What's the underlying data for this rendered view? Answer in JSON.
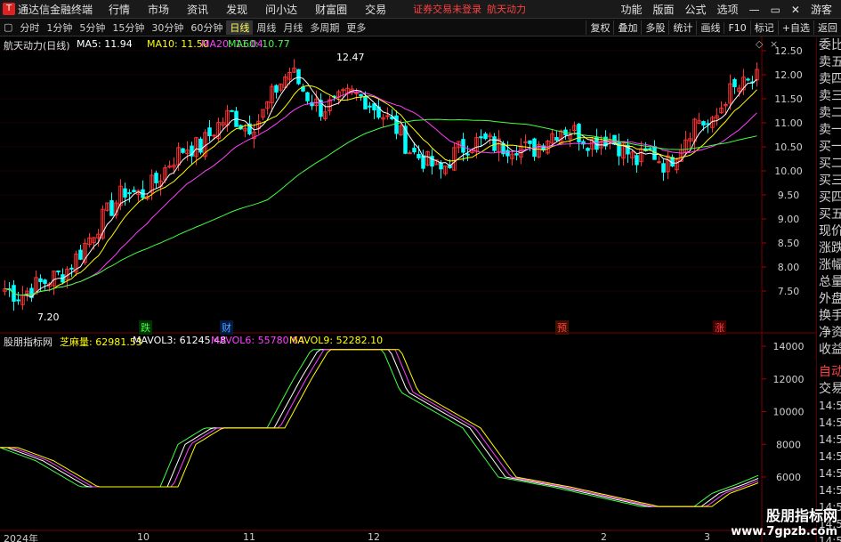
{
  "menubar": {
    "app_title": "通达信金融终端",
    "items": [
      "行情",
      "市场",
      "资讯",
      "发现",
      "问小达",
      "财富圈",
      "交易"
    ],
    "notice": "证券交易未登录",
    "stock": "航天动力",
    "right": [
      "功能",
      "版面",
      "公式",
      "选项"
    ],
    "guest": "游客"
  },
  "toolbar": {
    "periods": [
      "分时",
      "1分钟",
      "5分钟",
      "15分钟",
      "30分钟",
      "60分钟",
      "日线",
      "周线",
      "月线",
      "多周期",
      "更多"
    ],
    "active": "日线",
    "right": [
      "复权",
      "叠加",
      "多股",
      "统计",
      "画线",
      "F10",
      "标记",
      "+自选",
      "返回"
    ]
  },
  "main_chart": {
    "title": "航天动力(日线)",
    "ma_labels": [
      {
        "text": "MA5: 11.94",
        "color": "#ffffff"
      },
      {
        "text": "MA10: 11.50",
        "color": "#ffff00"
      },
      {
        "text": "MA20: 11.04",
        "color": "#ff40ff"
      },
      {
        "text": "MA60: 10.77",
        "color": "#40ff40"
      }
    ],
    "high_label": "12.47",
    "low_label": "7.20",
    "price_axis": [
      "12.50",
      "12.00",
      "11.50",
      "11.00",
      "10.50",
      "10.00",
      "9.50",
      "9.00",
      "8.50",
      "8.00",
      "7.50"
    ],
    "markers": [
      {
        "text": "跌",
        "color": "#40ff40",
        "bg": "#003300"
      },
      {
        "text": "财",
        "color": "#5aa0ff",
        "bg": "#001a40"
      },
      {
        "text": "预",
        "color": "#ff4040",
        "bg": "#401000"
      },
      {
        "text": "涨",
        "color": "#ff4040",
        "bg": "#400000"
      }
    ]
  },
  "indicator": {
    "title": "股朋指标网",
    "vol_label": "芝麻量: 62981.53",
    "mavol_labels": [
      {
        "text": "MAVOL3: 61245.48",
        "color": "#ffffff"
      },
      {
        "text": "MAVOL6: 55780.64",
        "color": "#ff40ff"
      },
      {
        "text": "MAVOL9: 52282.10",
        "color": "#ffff00"
      }
    ],
    "axis": [
      "14000",
      "12000",
      "10000",
      "8000",
      "6000"
    ]
  },
  "side_tabs": [
    {
      "label": "委比",
      "color": "normal"
    },
    {
      "label": "卖五",
      "color": "normal"
    },
    {
      "label": "卖四",
      "color": "normal"
    },
    {
      "label": "卖三",
      "color": "normal"
    },
    {
      "label": "卖二",
      "color": "normal"
    },
    {
      "label": "卖一",
      "color": "normal"
    },
    {
      "label": "买一",
      "color": "normal"
    },
    {
      "label": "买二",
      "color": "normal"
    },
    {
      "label": "买三",
      "color": "normal"
    },
    {
      "label": "买四",
      "color": "normal"
    },
    {
      "label": "买五",
      "color": "normal"
    },
    {
      "label": "现价",
      "color": "normal"
    },
    {
      "label": "涨跌",
      "color": "normal"
    },
    {
      "label": "涨幅",
      "color": "normal"
    },
    {
      "label": "总量",
      "color": "normal"
    },
    {
      "label": "外盘",
      "color": "normal"
    },
    {
      "label": "换手",
      "color": "normal"
    },
    {
      "label": "净资",
      "color": "normal"
    },
    {
      "label": "收益",
      "color": "normal"
    }
  ],
  "trade_side": {
    "auto": "自动",
    "trade": "交易",
    "times": [
      "14:5",
      "14:5",
      "14:5",
      "14:5",
      "14:5",
      "14:5",
      "14:5",
      "14:5",
      "14:5",
      "14:5"
    ]
  },
  "date_axis": [
    "2024年",
    "10",
    "11",
    "12",
    "2",
    "3"
  ],
  "watermark": {
    "line1": "股朋指标网",
    "line2": "www.7gpzb.com"
  },
  "colors": {
    "up": "#ff3030",
    "down": "#00ffff",
    "ma5": "#ffffff",
    "ma10": "#ffff00",
    "ma20": "#ff40ff",
    "ma60": "#40ff40"
  }
}
